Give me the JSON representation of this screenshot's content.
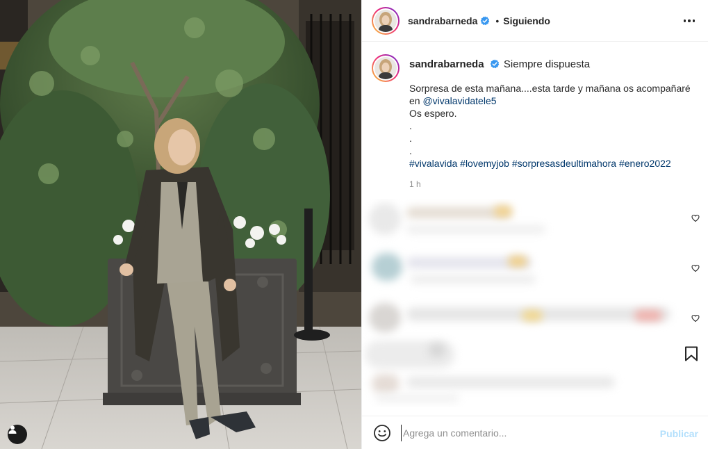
{
  "header": {
    "username": "sandrabarneda",
    "separator": "•",
    "follow_label": "Siguiendo",
    "more_icon": "more-horizontal-icon"
  },
  "caption": {
    "username": "sandrabarneda",
    "bio": "Siempre dispuesta",
    "line1": "Sorpresa de esta mañana....esta tarde y mañana os acompañaré",
    "line2_prefix": "en ",
    "mention": "@vivalavidatele5",
    "line3": "Os espero.",
    "dot": ".",
    "hashtags": [
      "#vivalavida",
      "#lovemyjob",
      "#sorpresasdeultimahora",
      "#enero2022"
    ],
    "time": "1 h"
  },
  "comments": {
    "blurred": true,
    "count_visible": 4
  },
  "composer": {
    "placeholder": "Agrega un comentario...",
    "publish_label": "Publicar"
  },
  "colors": {
    "link": "#00376b",
    "publish_disabled": "#b2dffc",
    "verified": "#3897f0",
    "muted": "#8e8e8e"
  }
}
